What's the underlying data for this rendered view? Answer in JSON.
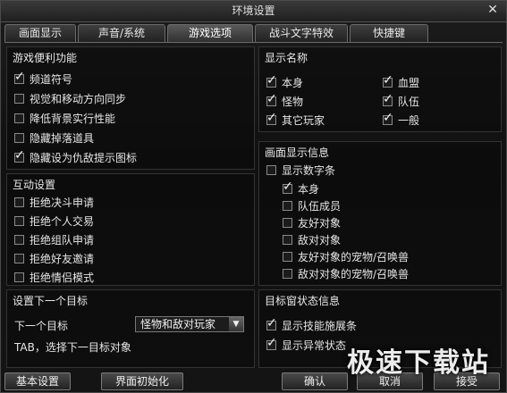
{
  "window": {
    "title": "环境设置",
    "close": "✕"
  },
  "tabs": [
    {
      "label": "画面显示"
    },
    {
      "label": "声音/系统"
    },
    {
      "label": "游戏选项",
      "active": true
    },
    {
      "label": "战斗文字特效"
    },
    {
      "label": "快捷键"
    }
  ],
  "convenience": {
    "title": "游戏便利功能",
    "items": [
      {
        "label": "频道符号",
        "checked": true
      },
      {
        "label": "视觉和移动方向同步",
        "checked": false
      },
      {
        "label": "降低背景实行性能",
        "checked": false
      },
      {
        "label": "隐藏掉落道具",
        "checked": false
      },
      {
        "label": "隐藏设为仇敌提示图标",
        "checked": true
      }
    ]
  },
  "display_name": {
    "title": "显示名称",
    "items": [
      {
        "label": "本身",
        "checked": true
      },
      {
        "label": "血盟",
        "checked": true
      },
      {
        "label": "怪物",
        "checked": true
      },
      {
        "label": "队伍",
        "checked": true
      },
      {
        "label": "其它玩家",
        "checked": true
      },
      {
        "label": "一般",
        "checked": true
      }
    ]
  },
  "interaction": {
    "title": "互动设置",
    "items": [
      {
        "label": "拒绝决斗申请",
        "checked": false
      },
      {
        "label": "拒绝个人交易",
        "checked": false
      },
      {
        "label": "拒绝组队申请",
        "checked": false
      },
      {
        "label": "拒绝好友邀请",
        "checked": false
      },
      {
        "label": "拒绝情侣模式",
        "checked": false
      }
    ]
  },
  "screen_info": {
    "title": "画面显示信息",
    "items": [
      {
        "label": "显示数字条",
        "checked": false
      },
      {
        "label": "本身",
        "checked": true
      },
      {
        "label": "队伍成员",
        "checked": false
      },
      {
        "label": "友好对象",
        "checked": false
      },
      {
        "label": "敌对对象",
        "checked": false
      },
      {
        "label": "友好对象的宠物/召唤兽",
        "checked": false
      },
      {
        "label": "敌对对象的宠物/召唤兽",
        "checked": false
      }
    ]
  },
  "next_target": {
    "title": "设置下一个目标",
    "label": "下一个目标",
    "select_value": "怪物和敌对玩家",
    "hint": "TAB，选择下一目标对象"
  },
  "target_window": {
    "title": "目标窗状态信息",
    "items": [
      {
        "label": "显示技能施展条",
        "checked": true
      },
      {
        "label": "显示异常状态",
        "checked": true
      }
    ]
  },
  "buttons": {
    "basic": "基本设置",
    "reset": "界面初始化",
    "ok": "确认",
    "cancel": "取消",
    "accept": "接受"
  },
  "watermark": "极速下载站"
}
